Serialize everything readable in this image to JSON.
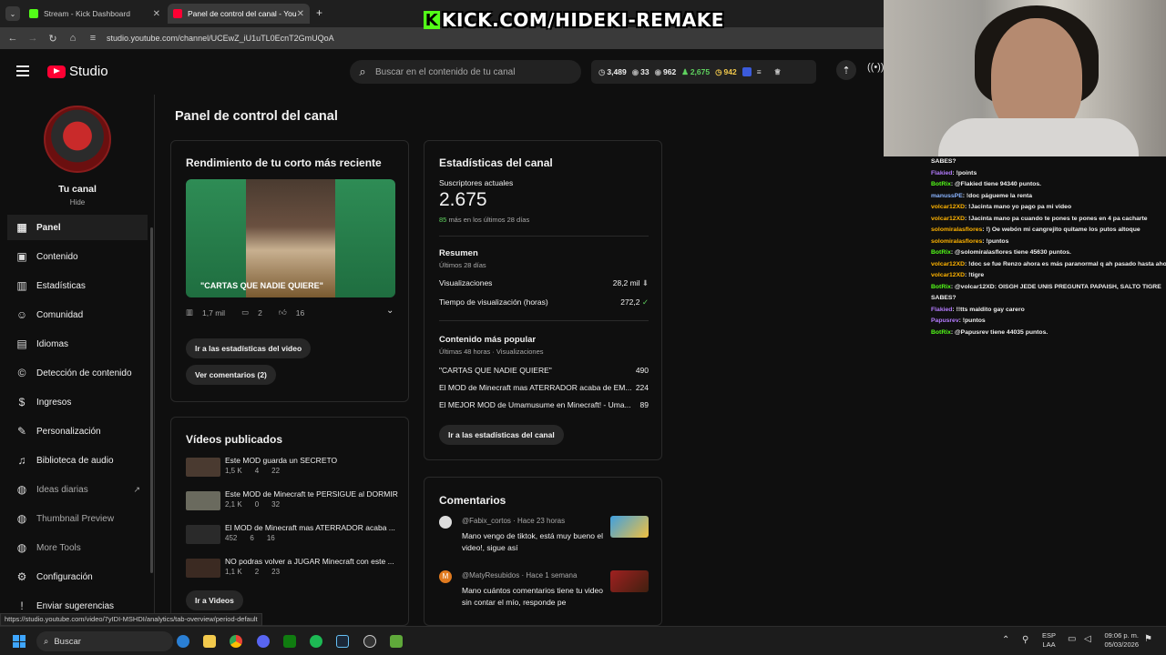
{
  "browser": {
    "tabs": [
      {
        "label": "Stream - Kick Dashboard",
        "color": "#53fc18"
      },
      {
        "label": "Panel de control del canal - You",
        "color": "#ff0033"
      }
    ],
    "url": "studio.youtube.com/channel/UCEwZ_iU1uTL0EcnT2GmUQoA",
    "status_url": "https://studio.youtube.com/video/7yIDI-MSHDI/analytics/tab-overview/period-default"
  },
  "overlay": {
    "kick_text": "KICK.COM/HIDEKI-REMAKE",
    "kick_letter": "K"
  },
  "header": {
    "logo": "Studio",
    "search_placeholder": "Buscar en el contenido de tu canal",
    "stats": [
      "3,489",
      "33",
      "962",
      "2,675",
      "942"
    ]
  },
  "sidebar": {
    "channel_title": "Tu canal",
    "channel_name": "Hide",
    "items": [
      {
        "label": "Panel",
        "icon": "dashboard-icon"
      },
      {
        "label": "Contenido",
        "icon": "content-icon"
      },
      {
        "label": "Estadísticas",
        "icon": "analytics-icon"
      },
      {
        "label": "Comunidad",
        "icon": "community-icon"
      },
      {
        "label": "Idiomas",
        "icon": "subtitles-icon"
      },
      {
        "label": "Detección de contenido",
        "icon": "copyright-icon"
      },
      {
        "label": "Ingresos",
        "icon": "dollar-icon"
      },
      {
        "label": "Personalización",
        "icon": "magic-wand-icon"
      },
      {
        "label": "Biblioteca de audio",
        "icon": "audio-library-icon"
      },
      {
        "label": "Ideas diarias",
        "icon": "extension-icon"
      },
      {
        "label": "Thumbnail Preview",
        "icon": "extension-icon"
      },
      {
        "label": "More Tools",
        "icon": "extension-icon"
      },
      {
        "label": "Configuración",
        "icon": "gear-icon"
      },
      {
        "label": "Enviar sugerencias",
        "icon": "feedback-icon"
      }
    ]
  },
  "main": {
    "title": "Panel de control del canal",
    "short": {
      "heading": "Rendimiento de tu corto más reciente",
      "caption": "\"CARTAS QUE NADIE QUIERE\"",
      "views": "1,7 mil",
      "comments": "2",
      "likes": "16",
      "btn_stats": "Ir a las estadísticas del video",
      "btn_comments": "Ver comentarios (2)"
    },
    "videos": {
      "heading": "Vídeos publicados",
      "items": [
        {
          "title": "Este MOD guarda un SECRETO",
          "views": "1,5 K",
          "comments": "4",
          "likes": "22"
        },
        {
          "title": "Este MOD de Minecraft te PERSIGUE al DORMIR",
          "views": "2,1 K",
          "comments": "0",
          "likes": "32"
        },
        {
          "title": "El MOD de Minecraft mas ATERRADOR acaba ...",
          "views": "452",
          "comments": "6",
          "likes": "16"
        },
        {
          "title": "NO podras volver a JUGAR Minecraft con este ...",
          "views": "1,1 K",
          "comments": "2",
          "likes": "23"
        }
      ],
      "btn": "Ir a Videos"
    },
    "channel_stats": {
      "heading": "Estadísticas del canal",
      "subs_label": "Suscriptores actuales",
      "subs": "2.675",
      "subs_delta": "85",
      "subs_delta_text": "más en los últimos 28 días",
      "summary_heading": "Resumen",
      "summary_period": "Últimos 28 días",
      "summary": [
        {
          "label": "Visualizaciones",
          "value": "28,2 mil"
        },
        {
          "label": "Tiempo de visualización (horas)",
          "value": "272,2"
        }
      ],
      "top_heading": "Contenido más popular",
      "top_period": "Últimas 48 horas · Visualizaciones",
      "top": [
        {
          "title": "\"CARTAS QUE NADIE QUIERE\"",
          "value": "490"
        },
        {
          "title": "El MOD de Minecraft mas ATERRADOR acaba de EM...",
          "value": "224"
        },
        {
          "title": "El MEJOR MOD de Umamusume en Minecraft! - Uma...",
          "value": "89"
        }
      ],
      "btn": "Ir a las estadísticas del canal"
    },
    "comments": {
      "heading": "Comentarios",
      "items": [
        {
          "user": "@Fabix_cortos",
          "time": "Hace 23 horas",
          "text": "Mano vengo de tiktok, está muy bueno el video!, sigue así",
          "avatar_letter": ""
        },
        {
          "user": "@MatyResubidos",
          "time": "Hace 1 semana",
          "text": "Mano cuántos comentarios tiene tu video sin contar el mío, responde pe",
          "avatar_letter": "M"
        }
      ]
    }
  },
  "chat": [
    {
      "user": "SABES?",
      "text": "",
      "color": "#f1f1f1"
    },
    {
      "user": "Flakied",
      "text": ": !points",
      "color": "#b57cff"
    },
    {
      "user": "BotRix",
      "text": ": @Flakied tiene 94340 puntos.",
      "color": "#53fc18"
    },
    {
      "user": "manussPE",
      "text": ": !doc páguеme la renta",
      "color": "#8ab4ff"
    },
    {
      "user": "volcar12XD",
      "text": ": !Jacinta mano yo pago pa mi video",
      "color": "#ffb300"
    },
    {
      "user": "volcar12XD",
      "text": ": !Jacinta mano pa cuando te pones te pones en 4 pa cacharte",
      "color": "#ffb300"
    },
    {
      "user": "solomiralasflores",
      "text": ": !) Oe webón mi cangrejito quitame los putos altoque",
      "color": "#ffb300"
    },
    {
      "user": "solomiralasflores",
      "text": ": !puntos",
      "color": "#ffb300"
    },
    {
      "user": "BotRix",
      "text": ": @solomiralasflores tiene 45630 puntos.",
      "color": "#53fc18"
    },
    {
      "user": "volcar12XD",
      "text": ": !doc se fue Renzo ahora es más paranormal q ah pasado hasta ahora",
      "color": "#ffb300"
    },
    {
      "user": "volcar12XD",
      "text": ": !tigre",
      "color": "#ffb300"
    },
    {
      "user": "BotRix",
      "text": ": @volcar12XD: OISGH JEDE UNIS PREGUNTA PAPAISH, SALTO TIGRE",
      "color": "#53fc18"
    },
    {
      "user": "SABES?",
      "text": "",
      "color": "#f1f1f1"
    },
    {
      "user": "Flakied",
      "text": ": !!tts maldito gay carero",
      "color": "#b57cff"
    },
    {
      "user": "Papusrev",
      "text": ": !puntos",
      "color": "#b57cff"
    },
    {
      "user": "BotRix",
      "text": ": @Papusrev tiene 44035 puntos.",
      "color": "#53fc18"
    }
  ],
  "taskbar": {
    "search": "Buscar",
    "lang": "ESP",
    "lang2": "LAA",
    "time": "09:06 p. m.",
    "date": "05/03/2026"
  }
}
